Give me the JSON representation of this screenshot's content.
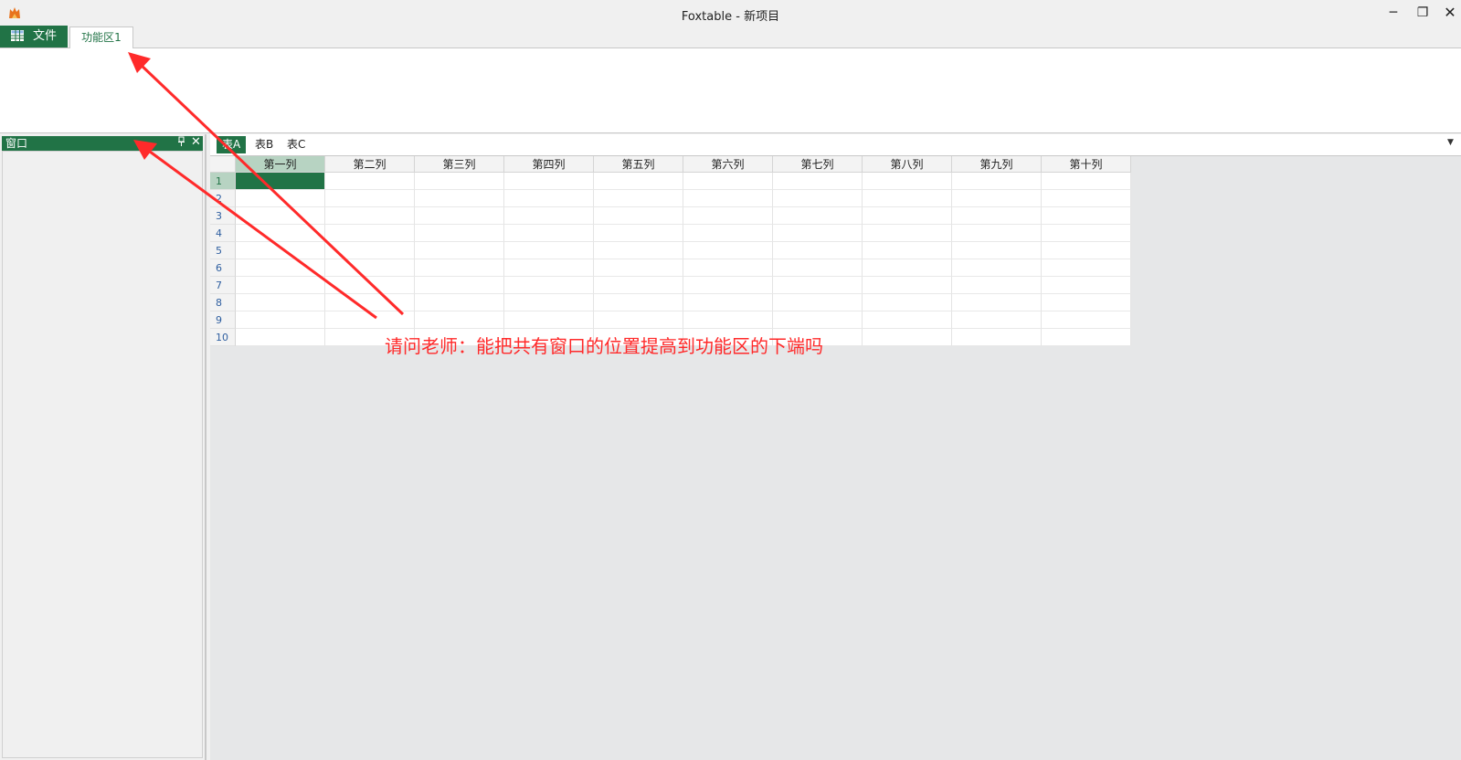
{
  "window": {
    "title": "Foxtable - 新项目",
    "min_glyph": "─",
    "max_glyph": "❐",
    "close_glyph": "✕"
  },
  "ribbon": {
    "file_tab": "文件",
    "tabs": [
      "功能区1"
    ]
  },
  "left_panel": {
    "title": "窗口",
    "pin_glyph": "ᵖ",
    "close_glyph": "✕"
  },
  "sheet_tabs": {
    "items": [
      "表A",
      "表B",
      "表C"
    ],
    "active_index": 0,
    "dropdown_glyph": "▼"
  },
  "grid": {
    "columns": [
      "第一列",
      "第二列",
      "第三列",
      "第四列",
      "第五列",
      "第六列",
      "第七列",
      "第八列",
      "第九列",
      "第十列"
    ],
    "rows": [
      "1",
      "2",
      "3",
      "4",
      "5",
      "6",
      "7",
      "8",
      "9",
      "10"
    ],
    "selected": {
      "row": 1,
      "col": 1
    }
  },
  "annotation": {
    "text": "请问老师：能把共有窗口的位置提高到功能区的下端吗",
    "color": "#ff2a2a"
  },
  "colors": {
    "accent": "#217346",
    "selected_header": "#b7d3c2",
    "row_number": "#2f5fa0"
  }
}
